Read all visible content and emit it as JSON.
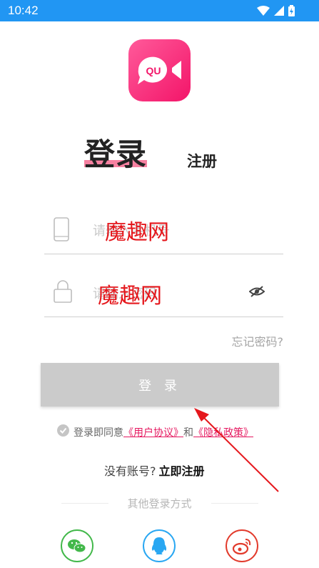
{
  "status_bar": {
    "time": "10:42"
  },
  "tabs": {
    "login": "登录",
    "register": "注册"
  },
  "fields": {
    "phone_placeholder": "请输入手机号",
    "password_placeholder": "请输入密码",
    "watermark": "魔趣网"
  },
  "forgot_password": "忘记密码?",
  "login_button": "登 录",
  "agreement": {
    "prefix": "登录即同意",
    "user_agreement": "《用户协议》",
    "and": "和",
    "privacy_policy": "《隐私政策》"
  },
  "signup": {
    "question": "没有账号?",
    "action": "立即注册"
  },
  "other_login": "其他登录方式",
  "logo_text": "QU",
  "colors": {
    "status_bar": "#2196f3",
    "brand_pink": "#f31569",
    "button_disabled": "#cbcbcb",
    "link": "#e5175f"
  }
}
